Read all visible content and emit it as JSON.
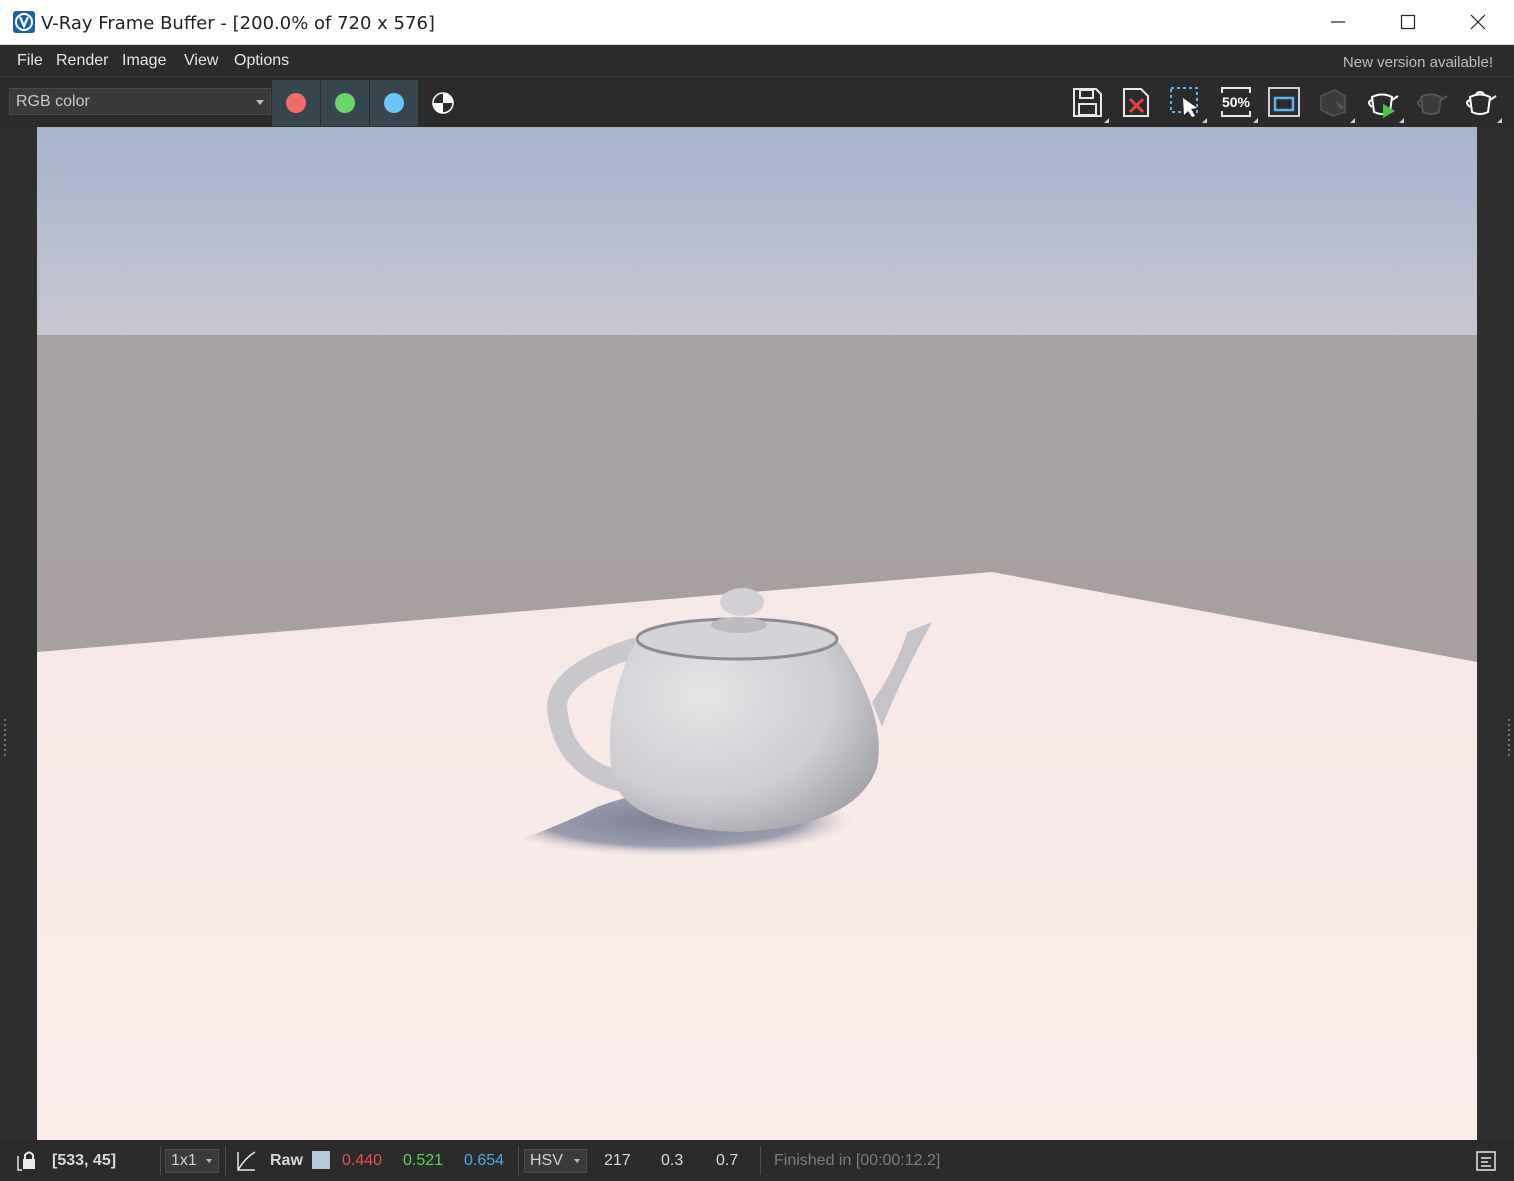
{
  "window": {
    "title": "V-Ray Frame Buffer - [200.0% of 720 x 576]",
    "icon": "vray-logo-icon"
  },
  "menu": {
    "items": [
      "File",
      "Render",
      "Image",
      "View",
      "Options"
    ],
    "notice": "New version available!"
  },
  "toolbar": {
    "channel": "RGB color",
    "channel_buttons": [
      {
        "name": "red-channel",
        "color": "#f26b6b"
      },
      {
        "name": "green-channel",
        "color": "#6bd46b"
      },
      {
        "name": "blue-channel",
        "color": "#6bc6f5"
      }
    ],
    "icons": [
      "mono-channel-icon",
      "save-image-icon",
      "clear-image-icon",
      "region-select-icon",
      "zoom-50-icon",
      "fit-window-icon",
      "track-mouse-icon",
      "render-last-icon",
      "render-interactive-icon",
      "abort-render-icon"
    ],
    "zoom_label": "50%"
  },
  "status": {
    "coords": "[533, 45]",
    "sample": "1x1",
    "mode": "Raw",
    "swatch_color": "#b7c7dc",
    "r": "0.440",
    "g": "0.521",
    "b": "0.654",
    "color_space": "HSV",
    "h": "217",
    "s": "0.3",
    "v": "0.7",
    "finished": "Finished in [00:00:12.2]",
    "colors": {
      "r": "#e65050",
      "g": "#56d456",
      "b": "#4da6e8"
    }
  }
}
